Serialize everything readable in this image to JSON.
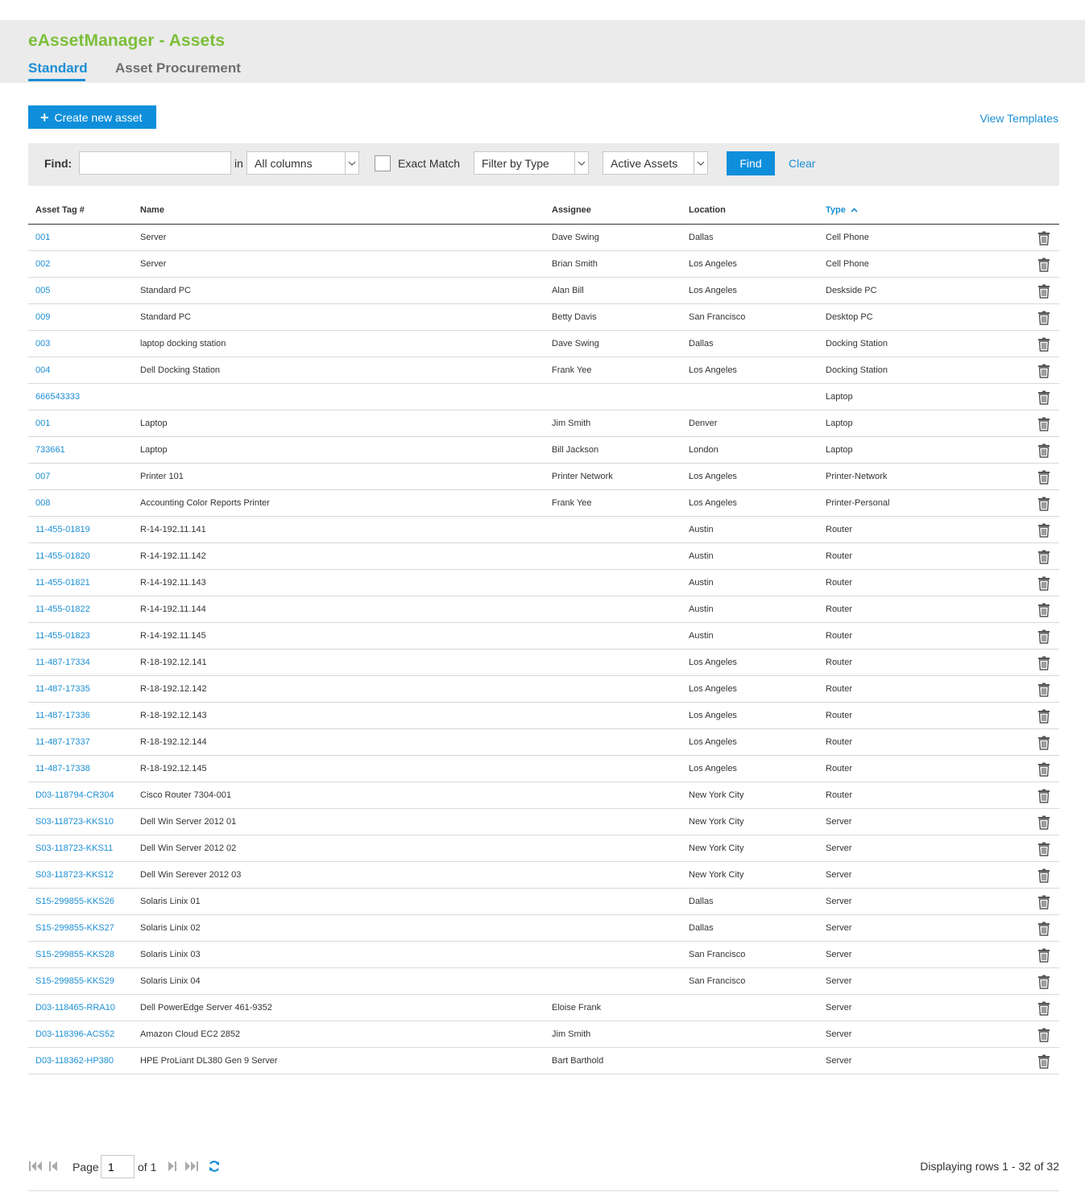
{
  "app": {
    "title": "eAssetManager - Assets"
  },
  "tabs": [
    {
      "label": "Standard",
      "active": true
    },
    {
      "label": "Asset Procurement",
      "active": false
    }
  ],
  "toolbar": {
    "create_label": "Create new asset",
    "view_templates": "View Templates"
  },
  "filter": {
    "find_label": "Find:",
    "find_value": "",
    "in_label": "in",
    "columns_select": "All columns",
    "exact_match_label": "Exact Match",
    "exact_match_checked": false,
    "type_select": "Filter by Type",
    "status_select": "Active Assets",
    "find_button": "Find",
    "clear_link": "Clear"
  },
  "table": {
    "headers": {
      "asset_tag": "Asset Tag #",
      "name": "Name",
      "assignee": "Assignee",
      "location": "Location",
      "type": "Type"
    },
    "sorted_column": "type",
    "sort_direction": "asc",
    "rows": [
      {
        "tag": "001",
        "name": "Server",
        "assignee": "Dave Swing",
        "location": "Dallas",
        "type": "Cell Phone"
      },
      {
        "tag": "002",
        "name": "Server",
        "assignee": "Brian Smith",
        "location": "Los Angeles",
        "type": "Cell Phone"
      },
      {
        "tag": "005",
        "name": "Standard PC",
        "assignee": "Alan Bill",
        "location": "Los Angeles",
        "type": "Deskside PC"
      },
      {
        "tag": "009",
        "name": "Standard PC",
        "assignee": "Betty Davis",
        "location": "San Francisco",
        "type": "Desktop PC"
      },
      {
        "tag": "003",
        "name": "laptop docking station",
        "assignee": "Dave Swing",
        "location": "Dallas",
        "type": "Docking Station"
      },
      {
        "tag": "004",
        "name": "Dell Docking Station",
        "assignee": "Frank Yee",
        "location": "Los Angeles",
        "type": "Docking Station"
      },
      {
        "tag": "666543333",
        "name": "",
        "assignee": "",
        "location": "",
        "type": "Laptop"
      },
      {
        "tag": "001",
        "name": "Laptop",
        "assignee": "Jim Smith",
        "location": "Denver",
        "type": "Laptop"
      },
      {
        "tag": "733661",
        "name": "Laptop",
        "assignee": "Bill Jackson",
        "location": "London",
        "type": "Laptop"
      },
      {
        "tag": "007",
        "name": "Printer 101",
        "assignee": "Printer Network",
        "location": "Los Angeles",
        "type": "Printer-Network"
      },
      {
        "tag": "008",
        "name": "Accounting Color Reports Printer",
        "assignee": "Frank Yee",
        "location": "Los Angeles",
        "type": "Printer-Personal"
      },
      {
        "tag": "11-455-01819",
        "name": "R-14-192.11.141",
        "assignee": "",
        "location": "Austin",
        "type": "Router"
      },
      {
        "tag": "11-455-01820",
        "name": "R-14-192.11.142",
        "assignee": "",
        "location": "Austin",
        "type": "Router"
      },
      {
        "tag": "11-455-01821",
        "name": "R-14-192.11.143",
        "assignee": "",
        "location": "Austin",
        "type": "Router"
      },
      {
        "tag": "11-455-01822",
        "name": "R-14-192.11.144",
        "assignee": "",
        "location": "Austin",
        "type": "Router"
      },
      {
        "tag": "11-455-01823",
        "name": "R-14-192.11.145",
        "assignee": "",
        "location": "Austin",
        "type": "Router"
      },
      {
        "tag": "11-487-17334",
        "name": "R-18-192.12.141",
        "assignee": "",
        "location": "Los Angeles",
        "type": "Router"
      },
      {
        "tag": "11-487-17335",
        "name": "R-18-192.12.142",
        "assignee": "",
        "location": "Los Angeles",
        "type": "Router"
      },
      {
        "tag": "11-487-17336",
        "name": "R-18-192.12.143",
        "assignee": "",
        "location": "Los Angeles",
        "type": "Router"
      },
      {
        "tag": "11-487-17337",
        "name": "R-18-192.12.144",
        "assignee": "",
        "location": "Los Angeles",
        "type": "Router"
      },
      {
        "tag": "11-487-17338",
        "name": "R-18-192.12.145",
        "assignee": "",
        "location": "Los Angeles",
        "type": "Router"
      },
      {
        "tag": "D03-118794-CR304",
        "name": "Cisco Router 7304-001",
        "assignee": "",
        "location": "New York City",
        "type": "Router"
      },
      {
        "tag": "S03-118723-KKS10",
        "name": "Dell Win Server 2012 01",
        "assignee": "",
        "location": "New York City",
        "type": "Server"
      },
      {
        "tag": "S03-118723-KKS11",
        "name": "Dell Win Server 2012 02",
        "assignee": "",
        "location": "New York City",
        "type": "Server"
      },
      {
        "tag": "S03-118723-KKS12",
        "name": "Dell Win Serever 2012 03",
        "assignee": "",
        "location": "New York City",
        "type": "Server"
      },
      {
        "tag": "S15-299855-KKS26",
        "name": "Solaris Linix 01",
        "assignee": "",
        "location": "Dallas",
        "type": "Server"
      },
      {
        "tag": "S15-299855-KKS27",
        "name": "Solaris Linix 02",
        "assignee": "",
        "location": "Dallas",
        "type": "Server"
      },
      {
        "tag": "S15-299855-KKS28",
        "name": "Solaris Linix 03",
        "assignee": "",
        "location": "San Francisco",
        "type": "Server"
      },
      {
        "tag": "S15-299855-KKS29",
        "name": "Solaris Linix 04",
        "assignee": "",
        "location": "San Francisco",
        "type": "Server"
      },
      {
        "tag": "D03-118465-RRA10",
        "name": "Dell PowerEdge Server 461-9352",
        "assignee": "Eloise Frank",
        "location": "",
        "type": "Server"
      },
      {
        "tag": "D03-118396-ACS52",
        "name": "Amazon Cloud EC2 2852",
        "assignee": "Jim Smith",
        "location": "",
        "type": "Server"
      },
      {
        "tag": "D03-118362-HP380",
        "name": "HPE ProLiant DL380 Gen 9 Server",
        "assignee": "Bart Barthold",
        "location": "",
        "type": "Server"
      }
    ]
  },
  "pager": {
    "page_label": "Page",
    "page_value": "1",
    "of_label": "of 1",
    "display_info": "Displaying rows 1 - 32 of 32"
  },
  "colors": {
    "title_green": "#7cbf3a",
    "accent_blue": "#0f8fdb",
    "link_blue": "#1b8fd6",
    "header_bg": "#ebebeb"
  },
  "icons": {
    "create": "plus-icon",
    "delete": "trash-icon",
    "dropdown": "chevron-down-icon",
    "sort": "sort-asc-icon",
    "first": "first-page-icon",
    "prev": "prev-page-icon",
    "next": "next-page-icon",
    "last": "last-page-icon",
    "refresh": "refresh-icon"
  }
}
